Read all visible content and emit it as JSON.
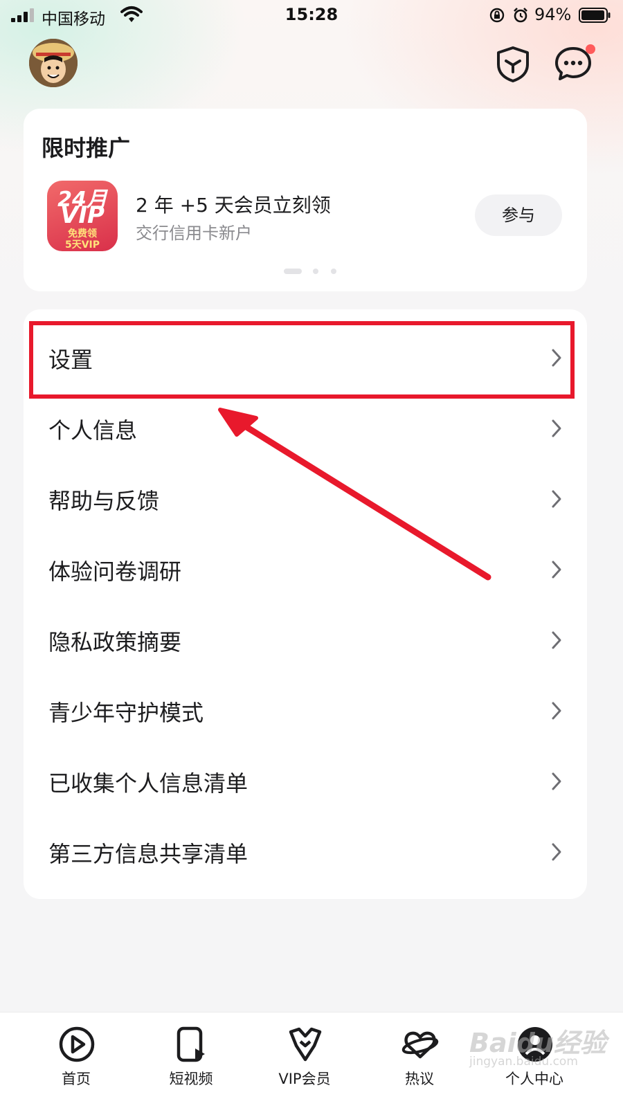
{
  "status_bar": {
    "carrier": "中国移动",
    "time": "15:28",
    "battery_percent": "94%"
  },
  "header": {
    "avatar": "avatar",
    "icons": [
      "shield-icon",
      "message-icon"
    ],
    "has_notification_dot": true
  },
  "promo": {
    "title": "限时推广",
    "icon_text": [
      "24月",
      "VIP",
      "免费领",
      "5天VIP"
    ],
    "headline": "2 年 +5 天会员立刻领",
    "subtitle": "交行信用卡新户",
    "button": "参与",
    "pager": {
      "count": 3,
      "active": 0
    }
  },
  "menu": {
    "items": [
      {
        "label": "设置"
      },
      {
        "label": "个人信息"
      },
      {
        "label": "帮助与反馈"
      },
      {
        "label": "体验问卷调研"
      },
      {
        "label": "隐私政策摘要"
      },
      {
        "label": "青少年守护模式"
      },
      {
        "label": "已收集个人信息清单"
      },
      {
        "label": "第三方信息共享清单"
      }
    ],
    "highlighted": "设置"
  },
  "tabs": [
    {
      "label": "首页",
      "icon": "play-icon"
    },
    {
      "label": "短视频",
      "icon": "short-video-icon"
    },
    {
      "label": "VIP会员",
      "icon": "vip-icon"
    },
    {
      "label": "热议",
      "icon": "planet-icon"
    },
    {
      "label": "个人中心",
      "icon": "profile-icon",
      "active": true
    }
  ],
  "watermark": {
    "text": "Baidu经验",
    "sub": "jingyan.baidu.com"
  },
  "colors": {
    "highlight": "#e8192c",
    "promo_icon": "#e04a55",
    "notification_dot": "#ff5b5b"
  }
}
